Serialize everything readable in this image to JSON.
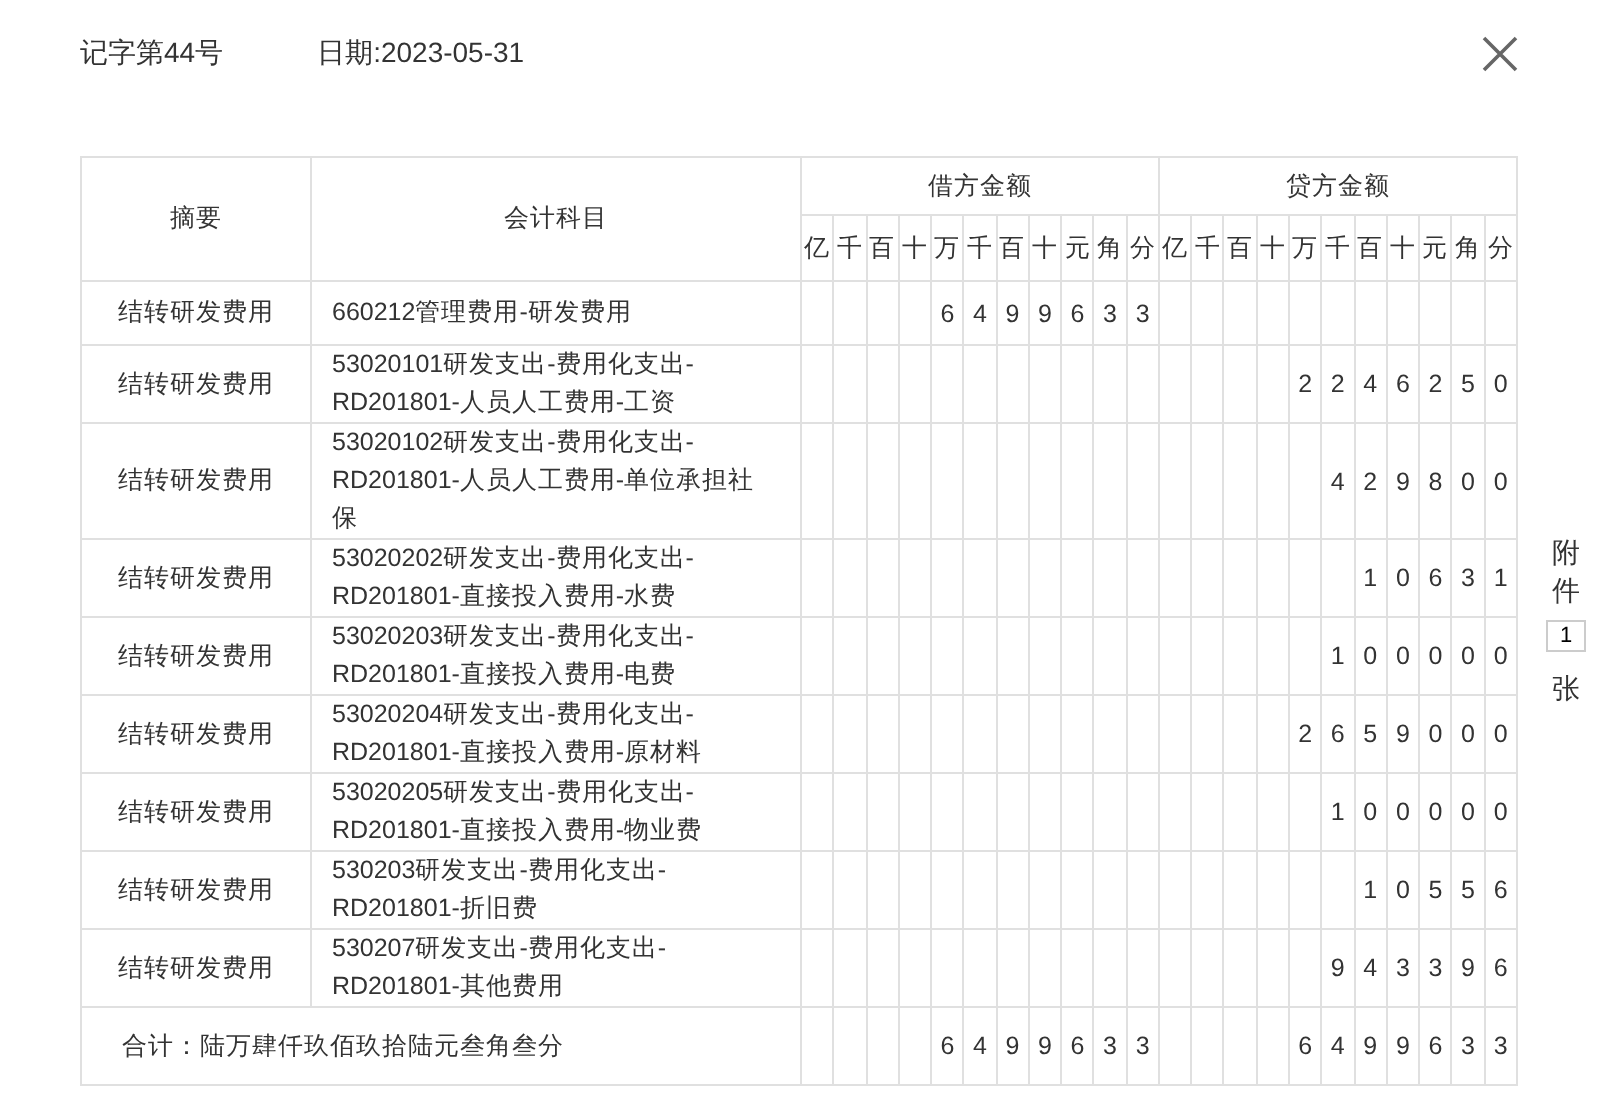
{
  "header": {
    "voucher_no": "记字第44号",
    "date": "日期:2023-05-31"
  },
  "table": {
    "columns": [
      "摘要",
      "会计科目"
    ],
    "debit_header": "借方金额",
    "credit_header": "贷方金额",
    "debit_units": [
      "亿",
      "千",
      "百",
      "十",
      "万",
      "千",
      "百",
      "十",
      "元",
      "角",
      "分"
    ],
    "credit_units": [
      "亿",
      "千",
      "百",
      "十",
      "万",
      "千",
      "百",
      "十",
      "元",
      "角",
      "分"
    ],
    "rows": [
      {
        "summary": "结转研发费用",
        "account": "660212管理费用-研发费用",
        "debit": [
          "6",
          "4",
          "9",
          "9",
          "6",
          "3",
          "3"
        ]
      },
      {
        "summary": "结转研发费用",
        "account": "53020101研发支出-费用化支出-RD201801-人员人工费用-工资",
        "credit": [
          "2",
          "2",
          "4",
          "6",
          "2",
          "5",
          "0"
        ]
      },
      {
        "summary": "结转研发费用",
        "account": "53020102研发支出-费用化支出-RD201801-人员人工费用-单位承担社保",
        "credit": [
          "4",
          "2",
          "9",
          "8",
          "0",
          "0"
        ]
      },
      {
        "summary": "结转研发费用",
        "account": "53020202研发支出-费用化支出-RD201801-直接投入费用-水费",
        "credit": [
          "1",
          "0",
          "6",
          "3",
          "1"
        ]
      },
      {
        "summary": "结转研发费用",
        "account": "53020203研发支出-费用化支出-RD201801-直接投入费用-电费",
        "credit": [
          "1",
          "0",
          "0",
          "0",
          "0",
          "0"
        ]
      },
      {
        "summary": "结转研发费用",
        "account": "53020204研发支出-费用化支出-RD201801-直接投入费用-原材料",
        "credit": [
          "2",
          "6",
          "5",
          "9",
          "0",
          "0",
          "0"
        ]
      },
      {
        "summary": "结转研发费用",
        "account": "53020205研发支出-费用化支出-RD201801-直接投入费用-物业费",
        "credit": [
          "1",
          "0",
          "0",
          "0",
          "0",
          "0"
        ]
      },
      {
        "summary": "结转研发费用",
        "account": "530203研发支出-费用化支出-RD201801-折旧费",
        "credit": [
          "1",
          "0",
          "5",
          "5",
          "6"
        ]
      },
      {
        "summary": "结转研发费用",
        "account": "530207研发支出-费用化支出-RD201801-其他费用",
        "credit": [
          "9",
          "4",
          "3",
          "3",
          "9",
          "6"
        ]
      }
    ],
    "total": {
      "label": "合计：陆万肆仟玖佰玖拾陆元叁角叁分",
      "debit": [
        "6",
        "4",
        "9",
        "9",
        "6",
        "3",
        "3"
      ],
      "credit": [
        "6",
        "4",
        "9",
        "9",
        "6",
        "3",
        "3"
      ]
    }
  },
  "attachments": {
    "label_top": "附件",
    "count": "1",
    "label_bottom": "张"
  }
}
